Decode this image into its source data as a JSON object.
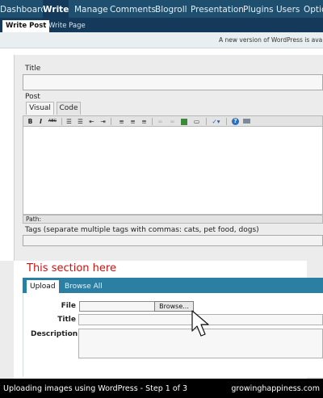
{
  "nav": {
    "items": [
      "Dashboard",
      "Write",
      "Manage",
      "Comments",
      "Blogroll",
      "Presentation",
      "Plugins",
      "Users",
      "Optio"
    ],
    "active": "Write"
  },
  "subnav": {
    "items": [
      "Write Post",
      "Write Page"
    ],
    "active": "Write Post"
  },
  "notice": {
    "text": "A new version of WordPress is ava"
  },
  "editor": {
    "title_label": "Title",
    "post_label": "Post",
    "tab_visual": "Visual",
    "tab_code": "Code",
    "toolbar_icons": [
      "bold-icon",
      "italic-icon",
      "strikethrough-icon",
      "bulleted-list-icon",
      "numbered-list-icon",
      "outdent-icon",
      "indent-icon",
      "align-left-icon",
      "align-center-icon",
      "align-right-icon",
      "link-icon",
      "unlink-icon",
      "image-icon",
      "more-icon",
      "spellcheck-icon",
      "help-icon",
      "toolbar-toggle-icon"
    ],
    "toolbar_glyphs": {
      "bold": "B",
      "italic": "I",
      "strike": "ABC",
      "help": "?"
    },
    "path_label": "Path:",
    "tags_label": "Tags (separate multiple tags with commas: cats, pet food, dogs)"
  },
  "highlight": {
    "title": "This section here",
    "title_color": "#cc1111"
  },
  "upload": {
    "tabs": [
      "Upload",
      "Browse All"
    ],
    "active": "Upload",
    "file_label": "File",
    "browse_label": "Browse...",
    "title_label": "Title",
    "description_label": "Description"
  },
  "caption": {
    "left": "Uploading images using WordPress - Step 1 of 3",
    "right": "growinghappiness.com"
  },
  "colors": {
    "nav_bg": "#1f4f6e",
    "nav_active": "#14395a",
    "upload_tab_bar": "#2b7fa3",
    "caption_bg": "#000000"
  }
}
